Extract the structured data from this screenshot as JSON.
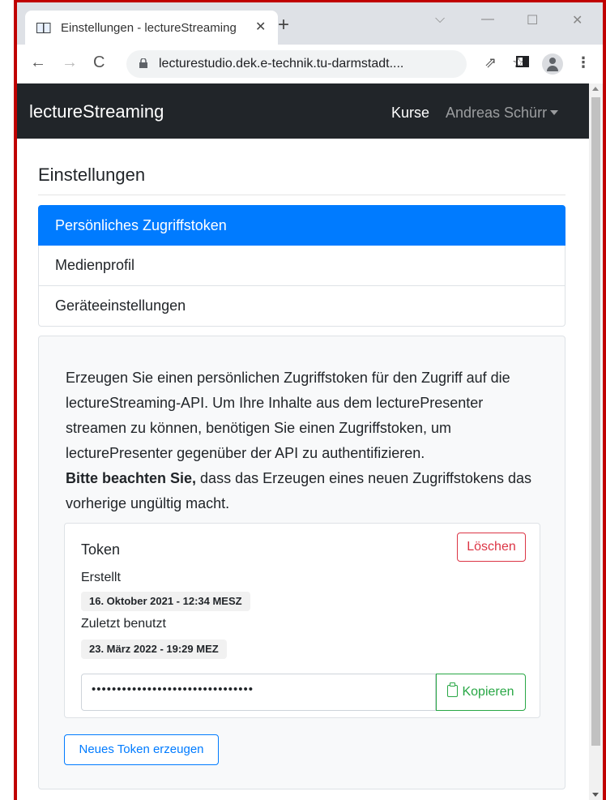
{
  "browser": {
    "tab_title": "Einstellungen - lectureStreaming",
    "url": "lecturestudio.dek.e-technik.tu-darmstadt....",
    "icons": {
      "tab_favicon": "book-icon",
      "close": "close-icon",
      "new_tab": "plus-icon",
      "back": "back-arrow-icon",
      "forward": "forward-arrow-icon",
      "reload": "reload-icon",
      "lock": "lock-icon",
      "share": "share-icon",
      "bookmark": "star-icon",
      "side_panel": "side-panel-icon",
      "profile": "profile-icon",
      "menu": "kebab-menu-icon"
    }
  },
  "navbar": {
    "brand": "lectureStreaming",
    "kurse": "Kurse",
    "user": "Andreas Schürr"
  },
  "page": {
    "title": "Einstellungen"
  },
  "settings_menu": [
    {
      "label": "Persönliches Zugriffstoken",
      "active": true
    },
    {
      "label": "Medienprofil",
      "active": false
    },
    {
      "label": "Geräteeinstellungen",
      "active": false
    }
  ],
  "token_panel": {
    "description": "Erzeugen Sie einen persönlichen Zugriffstoken für den Zugriff auf die lectureStreaming-API. Um Ihre Inhalte aus dem lecturePresenter streamen zu können, benötigen Sie einen Zugriffstoken, um lecturePresenter gegenüber der API zu authentifizieren.",
    "note_bold": "Bitte beachten Sie,",
    "note_rest": " dass das Erzeugen eines neuen Zugriffstokens das vorherige ungültig macht.",
    "token": {
      "title": "Token",
      "delete_label": "Löschen",
      "created_label": "Erstellt",
      "created_value": "16. Oktober 2021 - 12:34 MESZ",
      "last_used_label": "Zuletzt benutzt",
      "last_used_value": "23. März 2022 - 19:29 MEZ",
      "value": "••••••••••••••••••••••••••••••••",
      "copy_label": "Kopieren"
    },
    "new_token_label": "Neues Token erzeugen"
  },
  "colors": {
    "navbar_bg": "#212529",
    "active_item": "#007bff",
    "danger": "#dc3545",
    "success": "#28a745",
    "frame_border": "#c00000"
  }
}
